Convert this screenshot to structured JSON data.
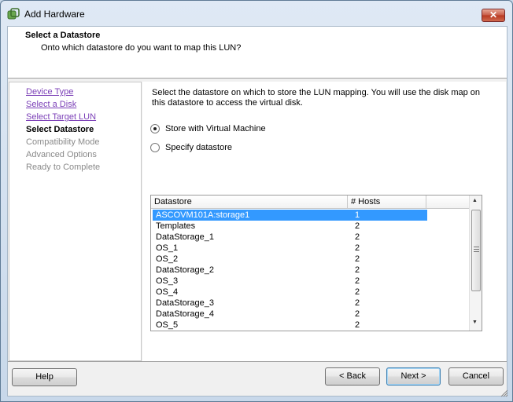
{
  "window": {
    "title": "Add Hardware",
    "close_label": "✕"
  },
  "header": {
    "title": "Select a Datastore",
    "subtitle": "Onto which datastore do you want to map this LUN?"
  },
  "nav": {
    "items": [
      {
        "label": "Device Type",
        "state": "link"
      },
      {
        "label": "Select a Disk",
        "state": "link"
      },
      {
        "label": "Select Target LUN",
        "state": "link"
      },
      {
        "label": "Select Datastore",
        "state": "current"
      },
      {
        "label": "Compatibility Mode",
        "state": "disabled"
      },
      {
        "label": "Advanced Options",
        "state": "disabled"
      },
      {
        "label": "Ready to Complete",
        "state": "disabled"
      }
    ]
  },
  "content": {
    "description": "Select the datastore on which to store the LUN mapping. You will use the disk map on this datastore to access the virtual disk.",
    "options": [
      {
        "label": "Store with Virtual Machine",
        "checked": true
      },
      {
        "label": "Specify datastore",
        "checked": false
      }
    ]
  },
  "table": {
    "columns": [
      "Datastore",
      "# Hosts"
    ],
    "rows": [
      {
        "datastore": "ASCOVM101A:storage1",
        "hosts": "1",
        "selected": true
      },
      {
        "datastore": "Templates",
        "hosts": "2"
      },
      {
        "datastore": "DataStorage_1",
        "hosts": "2"
      },
      {
        "datastore": "OS_1",
        "hosts": "2"
      },
      {
        "datastore": "OS_2",
        "hosts": "2"
      },
      {
        "datastore": "DataStorage_2",
        "hosts": "2"
      },
      {
        "datastore": "OS_3",
        "hosts": "2"
      },
      {
        "datastore": "OS_4",
        "hosts": "2"
      },
      {
        "datastore": "DataStorage_3",
        "hosts": "2"
      },
      {
        "datastore": "DataStorage_4",
        "hosts": "2"
      },
      {
        "datastore": "OS_5",
        "hosts": "2"
      }
    ]
  },
  "buttons": {
    "help": "Help",
    "back": "< Back",
    "next": "Next >",
    "cancel": "Cancel"
  },
  "colors": {
    "selection": "#3399ff",
    "link": "#7b3fb7"
  }
}
